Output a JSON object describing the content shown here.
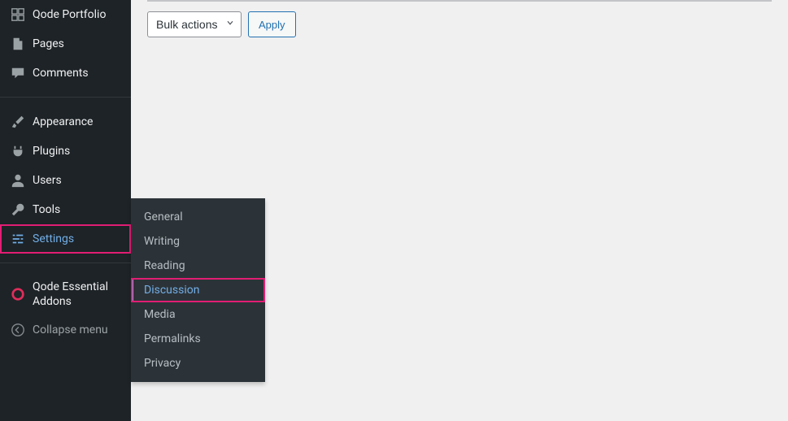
{
  "toolbar": {
    "bulk_label": "Bulk actions",
    "apply_label": "Apply"
  },
  "sidebar": {
    "items": [
      {
        "id": "qode-portfolio",
        "label": "Qode Portfolio",
        "icon": "grid-icon"
      },
      {
        "id": "pages",
        "label": "Pages",
        "icon": "page-icon"
      },
      {
        "id": "comments",
        "label": "Comments",
        "icon": "comment-icon"
      },
      {
        "id": "appearance",
        "label": "Appearance",
        "icon": "brush-icon"
      },
      {
        "id": "plugins",
        "label": "Plugins",
        "icon": "plug-icon"
      },
      {
        "id": "users",
        "label": "Users",
        "icon": "user-icon"
      },
      {
        "id": "tools",
        "label": "Tools",
        "icon": "wrench-icon"
      },
      {
        "id": "settings",
        "label": "Settings",
        "icon": "sliders-icon"
      },
      {
        "id": "qode-addons",
        "label": "Qode Essential Addons",
        "icon": "qode-icon"
      },
      {
        "id": "collapse",
        "label": "Collapse menu",
        "icon": "collapse-icon"
      }
    ]
  },
  "submenu": {
    "items": [
      {
        "label": "General"
      },
      {
        "label": "Writing"
      },
      {
        "label": "Reading"
      },
      {
        "label": "Discussion"
      },
      {
        "label": "Media"
      },
      {
        "label": "Permalinks"
      },
      {
        "label": "Privacy"
      }
    ]
  },
  "highlight_color": "#e11d73",
  "accent_color": "#72aee6"
}
